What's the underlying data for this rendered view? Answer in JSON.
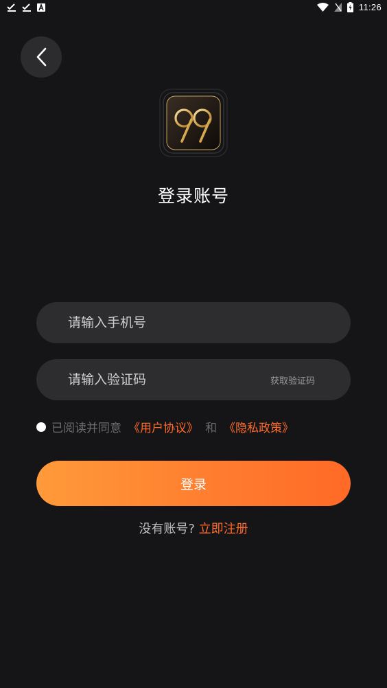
{
  "status_bar": {
    "time": "11:26",
    "left_icons": [
      "check-download-icon",
      "check-download-icon",
      "app-notification-icon"
    ],
    "right_icons": [
      "wifi-icon",
      "no-sim-icon",
      "battery-charging-icon"
    ]
  },
  "header": {
    "back_icon": "chevron-left-icon",
    "logo_text": "99",
    "title": "登录账号"
  },
  "form": {
    "phone_placeholder": "请输入手机号",
    "phone_value": "",
    "code_placeholder": "请输入验证码",
    "code_value": "",
    "get_code_label": "获取验证码"
  },
  "agreement": {
    "prefix": "已阅读并同意",
    "user_agreement": "《用户协议》",
    "and": "和",
    "privacy_policy": "《隐私政策》",
    "checked": false
  },
  "login_button": {
    "label": "登录"
  },
  "register": {
    "question": "没有账号?",
    "link": "立即注册"
  },
  "colors": {
    "background": "#151517",
    "field": "#2d2d30",
    "accent": "#ff6b2c",
    "button_gradient_start": "#ff9a3a",
    "button_gradient_end": "#ff6a26"
  }
}
